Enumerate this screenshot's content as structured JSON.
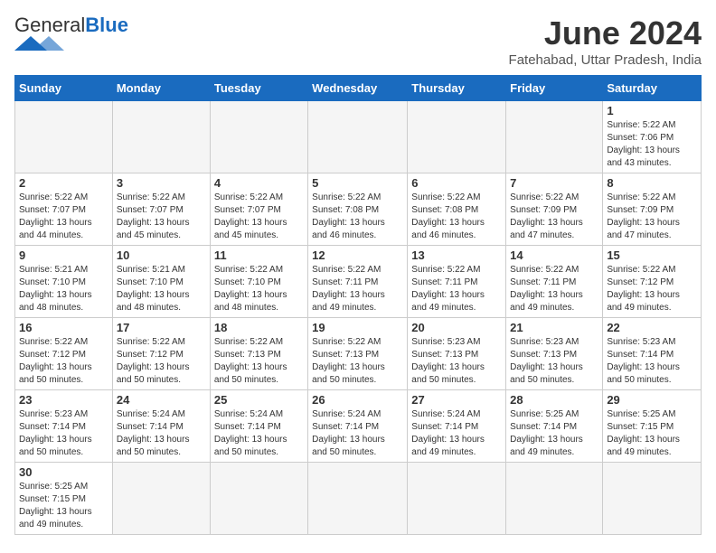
{
  "header": {
    "logo_general": "General",
    "logo_blue": "Blue",
    "month_title": "June 2024",
    "subtitle": "Fatehabad, Uttar Pradesh, India"
  },
  "weekdays": [
    "Sunday",
    "Monday",
    "Tuesday",
    "Wednesday",
    "Thursday",
    "Friday",
    "Saturday"
  ],
  "weeks": [
    [
      {
        "day": "",
        "info": ""
      },
      {
        "day": "",
        "info": ""
      },
      {
        "day": "",
        "info": ""
      },
      {
        "day": "",
        "info": ""
      },
      {
        "day": "",
        "info": ""
      },
      {
        "day": "",
        "info": ""
      },
      {
        "day": "1",
        "info": "Sunrise: 5:22 AM\nSunset: 7:06 PM\nDaylight: 13 hours\nand 43 minutes."
      }
    ],
    [
      {
        "day": "2",
        "info": "Sunrise: 5:22 AM\nSunset: 7:07 PM\nDaylight: 13 hours\nand 44 minutes."
      },
      {
        "day": "3",
        "info": "Sunrise: 5:22 AM\nSunset: 7:07 PM\nDaylight: 13 hours\nand 45 minutes."
      },
      {
        "day": "4",
        "info": "Sunrise: 5:22 AM\nSunset: 7:07 PM\nDaylight: 13 hours\nand 45 minutes."
      },
      {
        "day": "5",
        "info": "Sunrise: 5:22 AM\nSunset: 7:08 PM\nDaylight: 13 hours\nand 46 minutes."
      },
      {
        "day": "6",
        "info": "Sunrise: 5:22 AM\nSunset: 7:08 PM\nDaylight: 13 hours\nand 46 minutes."
      },
      {
        "day": "7",
        "info": "Sunrise: 5:22 AM\nSunset: 7:09 PM\nDaylight: 13 hours\nand 47 minutes."
      },
      {
        "day": "8",
        "info": "Sunrise: 5:22 AM\nSunset: 7:09 PM\nDaylight: 13 hours\nand 47 minutes."
      }
    ],
    [
      {
        "day": "9",
        "info": "Sunrise: 5:21 AM\nSunset: 7:10 PM\nDaylight: 13 hours\nand 48 minutes."
      },
      {
        "day": "10",
        "info": "Sunrise: 5:21 AM\nSunset: 7:10 PM\nDaylight: 13 hours\nand 48 minutes."
      },
      {
        "day": "11",
        "info": "Sunrise: 5:22 AM\nSunset: 7:10 PM\nDaylight: 13 hours\nand 48 minutes."
      },
      {
        "day": "12",
        "info": "Sunrise: 5:22 AM\nSunset: 7:11 PM\nDaylight: 13 hours\nand 49 minutes."
      },
      {
        "day": "13",
        "info": "Sunrise: 5:22 AM\nSunset: 7:11 PM\nDaylight: 13 hours\nand 49 minutes."
      },
      {
        "day": "14",
        "info": "Sunrise: 5:22 AM\nSunset: 7:11 PM\nDaylight: 13 hours\nand 49 minutes."
      },
      {
        "day": "15",
        "info": "Sunrise: 5:22 AM\nSunset: 7:12 PM\nDaylight: 13 hours\nand 49 minutes."
      }
    ],
    [
      {
        "day": "16",
        "info": "Sunrise: 5:22 AM\nSunset: 7:12 PM\nDaylight: 13 hours\nand 50 minutes."
      },
      {
        "day": "17",
        "info": "Sunrise: 5:22 AM\nSunset: 7:12 PM\nDaylight: 13 hours\nand 50 minutes."
      },
      {
        "day": "18",
        "info": "Sunrise: 5:22 AM\nSunset: 7:13 PM\nDaylight: 13 hours\nand 50 minutes."
      },
      {
        "day": "19",
        "info": "Sunrise: 5:22 AM\nSunset: 7:13 PM\nDaylight: 13 hours\nand 50 minutes."
      },
      {
        "day": "20",
        "info": "Sunrise: 5:23 AM\nSunset: 7:13 PM\nDaylight: 13 hours\nand 50 minutes."
      },
      {
        "day": "21",
        "info": "Sunrise: 5:23 AM\nSunset: 7:13 PM\nDaylight: 13 hours\nand 50 minutes."
      },
      {
        "day": "22",
        "info": "Sunrise: 5:23 AM\nSunset: 7:14 PM\nDaylight: 13 hours\nand 50 minutes."
      }
    ],
    [
      {
        "day": "23",
        "info": "Sunrise: 5:23 AM\nSunset: 7:14 PM\nDaylight: 13 hours\nand 50 minutes."
      },
      {
        "day": "24",
        "info": "Sunrise: 5:24 AM\nSunset: 7:14 PM\nDaylight: 13 hours\nand 50 minutes."
      },
      {
        "day": "25",
        "info": "Sunrise: 5:24 AM\nSunset: 7:14 PM\nDaylight: 13 hours\nand 50 minutes."
      },
      {
        "day": "26",
        "info": "Sunrise: 5:24 AM\nSunset: 7:14 PM\nDaylight: 13 hours\nand 50 minutes."
      },
      {
        "day": "27",
        "info": "Sunrise: 5:24 AM\nSunset: 7:14 PM\nDaylight: 13 hours\nand 49 minutes."
      },
      {
        "day": "28",
        "info": "Sunrise: 5:25 AM\nSunset: 7:14 PM\nDaylight: 13 hours\nand 49 minutes."
      },
      {
        "day": "29",
        "info": "Sunrise: 5:25 AM\nSunset: 7:15 PM\nDaylight: 13 hours\nand 49 minutes."
      }
    ],
    [
      {
        "day": "30",
        "info": "Sunrise: 5:25 AM\nSunset: 7:15 PM\nDaylight: 13 hours\nand 49 minutes."
      },
      {
        "day": "",
        "info": ""
      },
      {
        "day": "",
        "info": ""
      },
      {
        "day": "",
        "info": ""
      },
      {
        "day": "",
        "info": ""
      },
      {
        "day": "",
        "info": ""
      },
      {
        "day": "",
        "info": ""
      }
    ]
  ]
}
